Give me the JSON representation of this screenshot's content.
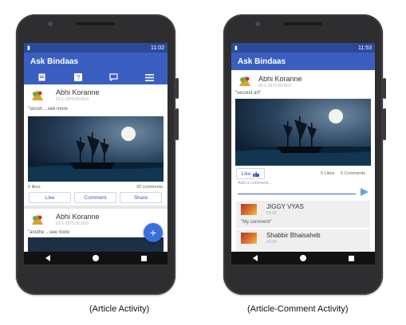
{
  "left_phone": {
    "status_time": "11:02",
    "app_title": "Ask Bindaas",
    "tabs": [
      {
        "icon": "document-icon"
      },
      {
        "icon": "help-icon"
      },
      {
        "icon": "chat-icon"
      },
      {
        "icon": "menu-icon"
      }
    ],
    "post1": {
      "author": "Abhi Koranne",
      "timestamp": "01-1-1970 05:30:0",
      "text": "\"secon ...see more",
      "likes": "5 likes",
      "comments": "20 comments",
      "like_label": "Like",
      "comment_label": "Comment",
      "share_label": "Share"
    },
    "post2": {
      "author": "Abhi Koranne",
      "timestamp": "01-1-1970 05:30:0",
      "text": "\"anothe ...see more"
    },
    "fab_label": "+"
  },
  "right_phone": {
    "status_time": "11:53",
    "app_title": "Ask Bindaas",
    "author": "Abhi Koranne",
    "timestamp": "01-1-1970 05:30:0",
    "post_text": "\"second art\"",
    "like_label": "Like",
    "likes": "5 Likes",
    "comments": "0 Comments",
    "comment_placeholder": "Add a comment...",
    "comment_list": [
      {
        "author": "JIGGY VYAS",
        "time": "03:35",
        "text": "\"My comment\""
      },
      {
        "author": "Shabbir Bhaisaheb",
        "time": "03:38",
        "text": ""
      }
    ]
  },
  "captions": {
    "left": "(Article Activity)",
    "right": "(Article-Comment Activity)"
  },
  "colors": {
    "appbar": "#3b5fc0",
    "statusbar": "#2c4a9a",
    "accent": "#3b6fe0"
  }
}
